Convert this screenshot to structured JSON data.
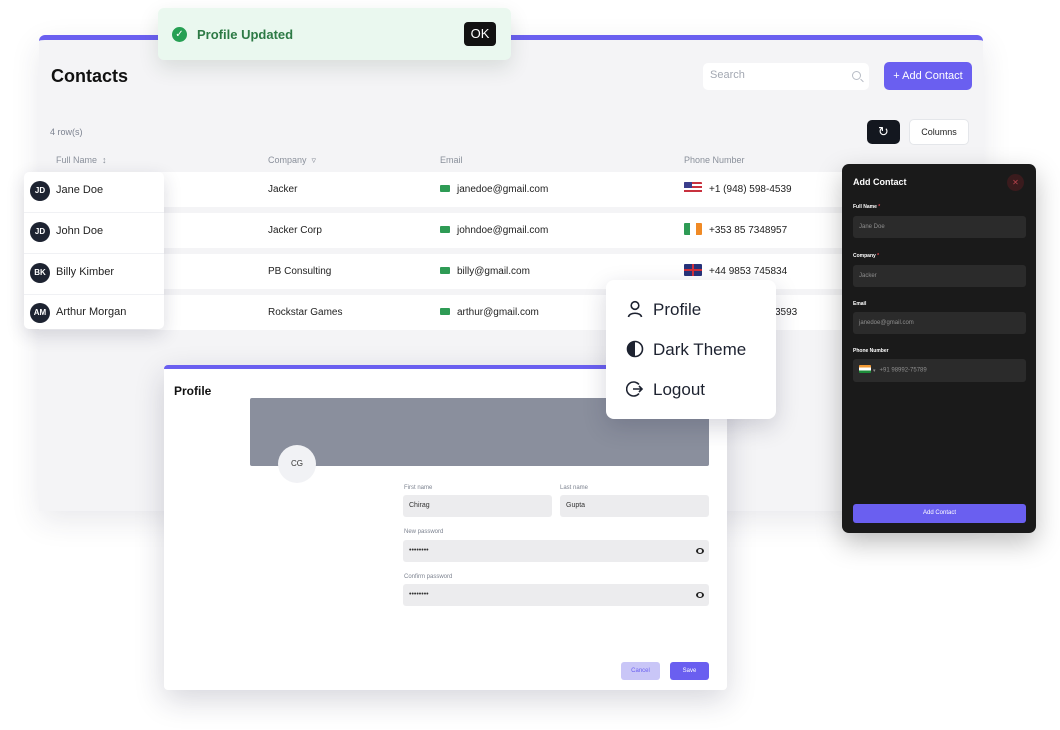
{
  "toast": {
    "text": "Profile Updated",
    "ok_label": "OK",
    "check_icon": "check-circle-icon"
  },
  "contacts": {
    "title": "Contacts",
    "search_placeholder": "Search",
    "add_contact_label": "+ Add Contact",
    "row_count": "4 row(s)",
    "refresh_icon": "refresh-icon",
    "columns_label": "Columns",
    "headers": {
      "full_name": "Full Name",
      "company": "Company",
      "email": "Email",
      "phone": "Phone Number"
    },
    "rows": [
      {
        "initials": "JD",
        "name": "Jane Doe",
        "company": "Jacker",
        "email": "janedoe@gmail.com",
        "phone": "+1 (948) 598-4539",
        "flag": "us"
      },
      {
        "initials": "JD",
        "name": "John Doe",
        "company": "Jacker Corp",
        "email": "johndoe@gmail.com",
        "phone": "+353 85 7348957",
        "flag": "ie"
      },
      {
        "initials": "BK",
        "name": "Billy Kimber",
        "company": "PB Consulting",
        "email": "billy@gmail.com",
        "phone": "+44 9853 745834",
        "flag": "gb"
      },
      {
        "initials": "AM",
        "name": "Arthur Morgan",
        "company": "Rockstar Games",
        "email": "arthur@gmail.com",
        "phone": "3593",
        "flag": "none"
      }
    ]
  },
  "profile": {
    "title": "Profile",
    "avatar_initials": "CG",
    "first_name_label": "First name",
    "first_name": "Chirag",
    "last_name_label": "Last name",
    "last_name": "Gupta",
    "new_password_label": "New password",
    "new_password": "••••••••",
    "confirm_password_label": "Confirm password",
    "confirm_password": "••••••••",
    "cancel_label": "Cancel",
    "save_label": "Save"
  },
  "user_menu": {
    "items": [
      {
        "label": "Profile",
        "icon": "user-icon"
      },
      {
        "label": "Dark Theme",
        "icon": "contrast-icon"
      },
      {
        "label": "Logout",
        "icon": "logout-icon"
      }
    ]
  },
  "add_contact_panel": {
    "title": "Add Contact",
    "close_icon": "close-icon",
    "full_name_label": "Full Name",
    "full_name_placeholder": "Jane Doe",
    "company_label": "Company",
    "company_placeholder": "Jacker",
    "email_label": "Email",
    "email_placeholder": "janedoe@gmail.com",
    "phone_label": "Phone Number",
    "phone_placeholder": "+91 98992-75789",
    "phone_flag": "in",
    "required_mark": "*",
    "submit_label": "Add Contact"
  },
  "colors": {
    "accent": "#6a5ff0",
    "success": "#27a054",
    "dark_panel": "#1a1a1a"
  }
}
